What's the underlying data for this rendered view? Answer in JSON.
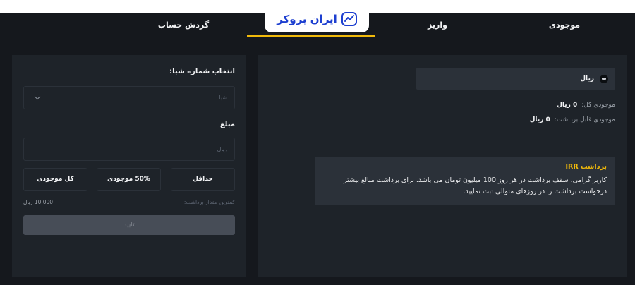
{
  "brand": {
    "logo_text": "ایران بروکر"
  },
  "tabs": {
    "balance": "موجودی",
    "deposit": "واریز",
    "history": "گردش حساب"
  },
  "wallet": {
    "currency": "ریال",
    "total_label": "موجودی کل:",
    "total_value": "0 ریال",
    "withdrawable_label": "موجودی قابل برداشت:",
    "withdrawable_value": "0 ریال"
  },
  "notice": {
    "title": "برداشت IRR",
    "body": "کاربر گرامی، سقف برداشت در هر روز 100 میلیون تومان می باشد. برای برداشت مبالغ بیشتر درخواست برداشت را در روزهای متوالی ثبت نمایید."
  },
  "form": {
    "sheba_label": "انتخاب شماره شبا:",
    "sheba_placeholder": "شبا",
    "amount_label": "مبلغ",
    "amount_placeholder": "ریال",
    "btn_min": "حداقل",
    "btn_half": "50% موجودی",
    "btn_all": "کل موجودی",
    "min_label": "کمترین مقدار برداشت:",
    "min_value": "10,000 ریال",
    "submit": "تایید"
  },
  "colors": {
    "accent": "#f0b90b",
    "brand_blue": "#1d3fd0",
    "panel": "#1e2329",
    "background": "#15181d"
  }
}
